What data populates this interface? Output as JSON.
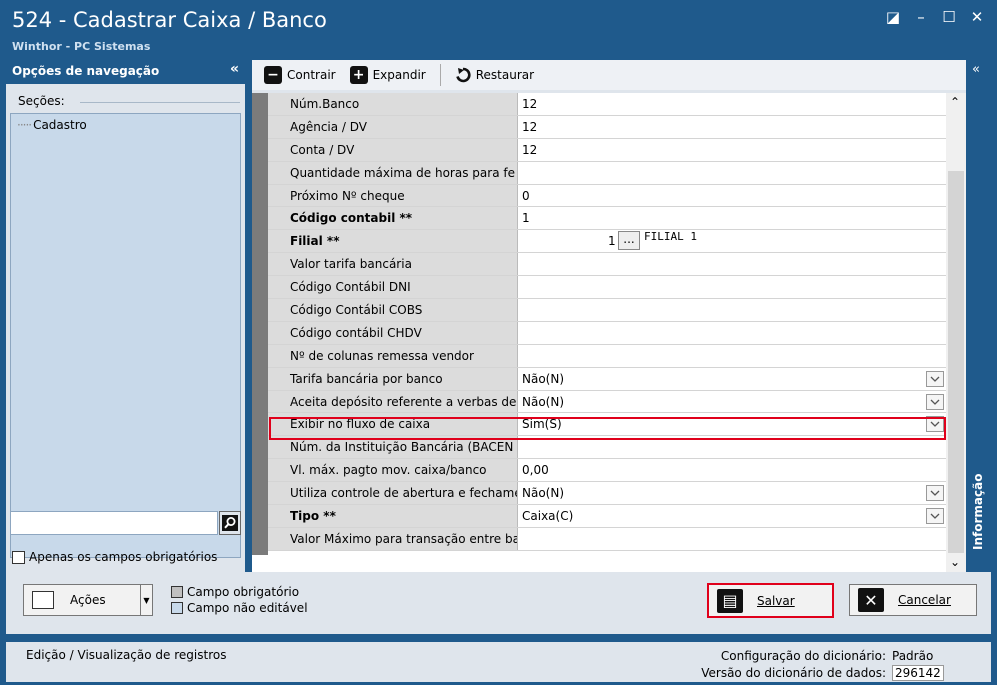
{
  "window": {
    "title": "524 - Cadastrar Caixa / Banco",
    "subtitle": "Winthor - PC Sistemas"
  },
  "nav": {
    "header": "Opções de navegação",
    "sections_label": "Seções:",
    "tree_item": "Cadastro",
    "only_required": "Apenas os campos obrigatórios"
  },
  "toolbar": {
    "contrair": "Contrair",
    "expandir": "Expandir",
    "restaurar": "Restaurar"
  },
  "rows": [
    {
      "label": "Núm.Banco",
      "value": "12",
      "bold": false,
      "dropdown": false
    },
    {
      "label": "Agência / DV",
      "value": "12",
      "bold": false,
      "dropdown": false
    },
    {
      "label": "Conta / DV",
      "value": "12",
      "bold": false,
      "dropdown": false
    },
    {
      "label": "Quantidade máxima de horas para fe",
      "value": "",
      "bold": false,
      "dropdown": false
    },
    {
      "label": "Próximo Nº cheque",
      "value": "0",
      "bold": false,
      "dropdown": false
    },
    {
      "label": "Código contabil **",
      "value": "1",
      "bold": true,
      "dropdown": false
    },
    {
      "label": "Filial **",
      "value": "",
      "bold": true,
      "dropdown": false
    },
    {
      "label": "Valor tarifa bancária",
      "value": "",
      "bold": false,
      "dropdown": false
    },
    {
      "label": "Código Contábil DNI",
      "value": "",
      "bold": false,
      "dropdown": false
    },
    {
      "label": "Código Contábil COBS",
      "value": "",
      "bold": false,
      "dropdown": false
    },
    {
      "label": "Código contábil CHDV",
      "value": "",
      "bold": false,
      "dropdown": false
    },
    {
      "label": "Nº de colunas remessa vendor",
      "value": "",
      "bold": false,
      "dropdown": false
    },
    {
      "label": "Tarifa bancária por banco",
      "value": "Não(N)",
      "bold": false,
      "dropdown": true
    },
    {
      "label": "Aceita depósito referente a verbas de",
      "value": "Não(N)",
      "bold": false,
      "dropdown": true
    },
    {
      "label": "Exibir no fluxo de caixa",
      "value": "Sim(S)",
      "bold": false,
      "dropdown": true
    },
    {
      "label": "Núm. da Instituição Bancária (BACEN",
      "value": "",
      "bold": false,
      "dropdown": false
    },
    {
      "label": "Vl. máx. pagto mov. caixa/banco",
      "value": "0,00",
      "bold": false,
      "dropdown": false
    },
    {
      "label": "Utiliza controle de abertura e fechame",
      "value": "Não(N)",
      "bold": false,
      "dropdown": true
    },
    {
      "label": "Tipo **",
      "value": "Caixa(C)",
      "bold": true,
      "dropdown": true
    },
    {
      "label": "Valor Máximo para transação entre ba",
      "value": "",
      "bold": false,
      "dropdown": false
    }
  ],
  "filial": {
    "number": "1",
    "button": "...",
    "name": "FILIAL 1"
  },
  "info_tab": "Informação",
  "bottom": {
    "acoes": "Ações",
    "legend_required": "Campo obrigatório",
    "legend_noneditable": "Campo não editável",
    "salvar": "Salvar",
    "cancelar": "Cancelar"
  },
  "status": {
    "left": "Edição / Visualização de registros",
    "config_label": "Configuração do dicionário:",
    "config_value": "Padrão",
    "version_label": "Versão do dicionário de dados:",
    "version_value": "296142"
  },
  "colors": {
    "primary": "#1f5a8c",
    "highlight": "#e0001b",
    "required_swatch": "#c0c0c0",
    "noneditable_swatch": "#c8d9ea"
  }
}
